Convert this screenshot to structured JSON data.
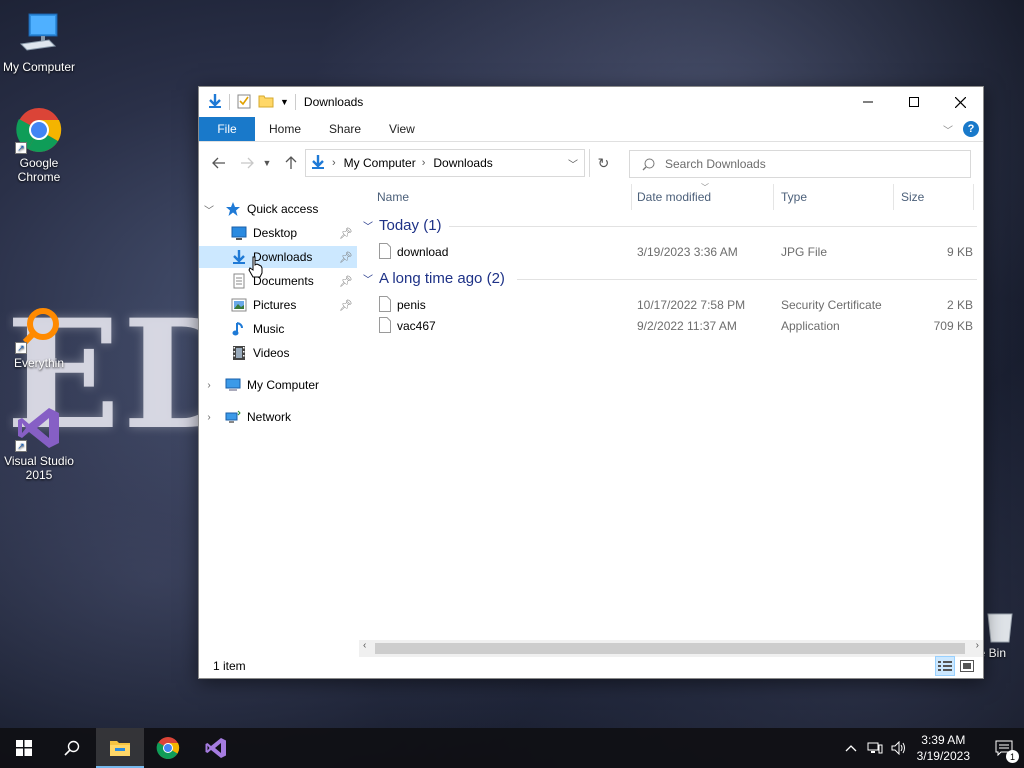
{
  "desktop": {
    "icons": [
      {
        "label": "My Computer"
      },
      {
        "label": "Google Chrome"
      },
      {
        "label": "Everythin"
      },
      {
        "label": "Visual Studio 2015"
      }
    ],
    "recycle_label": "e Bin"
  },
  "window": {
    "title": "Downloads",
    "ribbon": {
      "file": "File",
      "home": "Home",
      "share": "Share",
      "view": "View",
      "help": "?"
    },
    "address": {
      "segments": [
        "My Computer",
        "Downloads"
      ]
    },
    "search": {
      "placeholder": "Search Downloads"
    },
    "nav": {
      "quick_access": "Quick access",
      "items": [
        {
          "label": "Desktop",
          "pinned": true
        },
        {
          "label": "Downloads",
          "pinned": true,
          "selected": true
        },
        {
          "label": "Documents",
          "pinned": true
        },
        {
          "label": "Pictures",
          "pinned": true
        },
        {
          "label": "Music",
          "pinned": false
        },
        {
          "label": "Videos",
          "pinned": false
        }
      ],
      "my_computer": "My Computer",
      "network": "Network"
    },
    "columns": {
      "name": "Name",
      "date": "Date modified",
      "type": "Type",
      "size": "Size"
    },
    "groups": [
      {
        "title": "Today (1)",
        "files": [
          {
            "name": "download",
            "date": "3/19/2023 3:36 AM",
            "type": "JPG File",
            "size": "9 KB"
          }
        ]
      },
      {
        "title": "A long time ago (2)",
        "files": [
          {
            "name": "penis",
            "date": "10/17/2022 7:58 PM",
            "type": "Security Certificate",
            "size": "2 KB"
          },
          {
            "name": "vac467",
            "date": "9/2/2022 11:37 AM",
            "type": "Application",
            "size": "709 KB"
          }
        ]
      }
    ],
    "status": "1 item"
  },
  "taskbar": {
    "time": "3:39 AM",
    "date": "3/19/2023",
    "notification_count": "1"
  },
  "wallpaper_text": "EDN"
}
